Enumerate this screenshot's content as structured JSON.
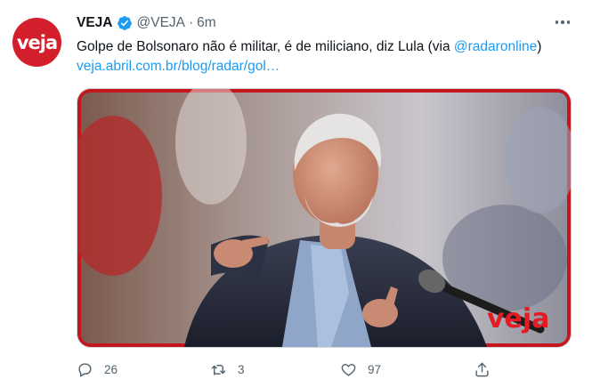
{
  "tweet": {
    "author_name": "VEJA",
    "author_handle": "@VEJA",
    "separator": "·",
    "time": "6m",
    "avatar_text": "veja",
    "text_main": "Golpe de Bolsonaro não é militar, é de miliciano, diz Lula (via ",
    "text_mention": "@radaronline",
    "text_close": ")",
    "link": "veja.abril.com.br/blog/radar/gol…",
    "media_watermark": "veja",
    "verified": true
  },
  "actions": {
    "reply_count": "26",
    "retweet_count": "3",
    "like_count": "97"
  },
  "icons": {
    "more": "more-horizontal-icon",
    "verified": "verified-badge-icon",
    "reply": "reply-icon",
    "retweet": "retweet-icon",
    "like": "heart-icon",
    "share": "share-icon"
  },
  "colors": {
    "accent": "#1d9bf0",
    "brand_red": "#d31f2b",
    "secondary_text": "#536471"
  }
}
